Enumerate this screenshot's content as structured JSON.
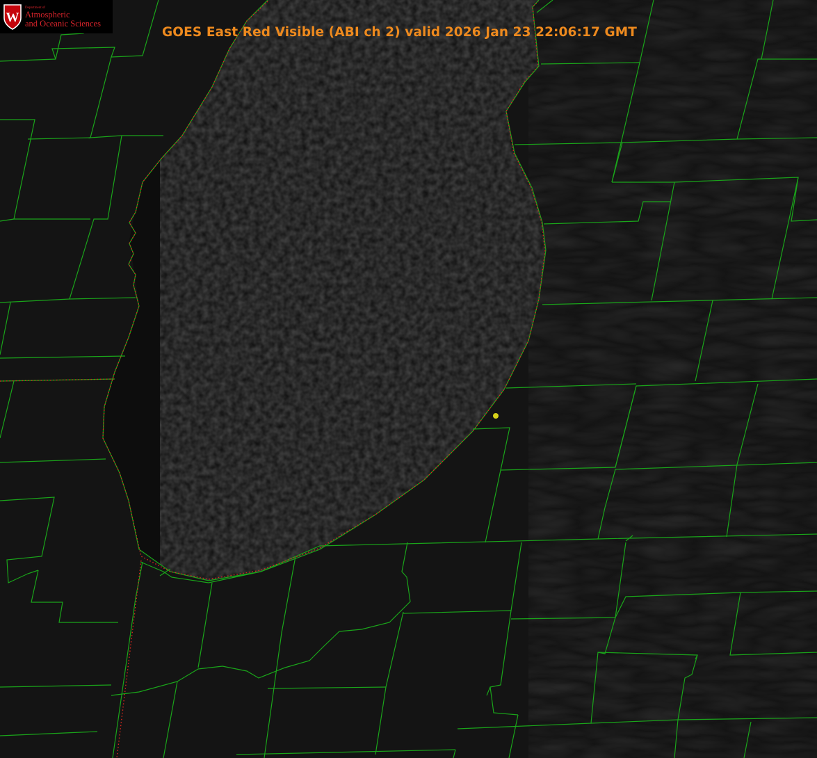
{
  "logo": {
    "dept": "Department of",
    "line1": "Atmospheric",
    "line2": "and Oceanic Sciences",
    "crest_letter": "W",
    "color": "#d6232a"
  },
  "title": "GOES East Red Visible (ABI ch 2) valid 2026 Jan 23 22:06:17 GMT",
  "colors": {
    "title": "#ee8a1e",
    "county_lines": "#1aa51a",
    "shoreline_dots": "#d8281e",
    "marker": "#d7d21a",
    "land": "#141414",
    "lake": "#0b0b0b"
  }
}
